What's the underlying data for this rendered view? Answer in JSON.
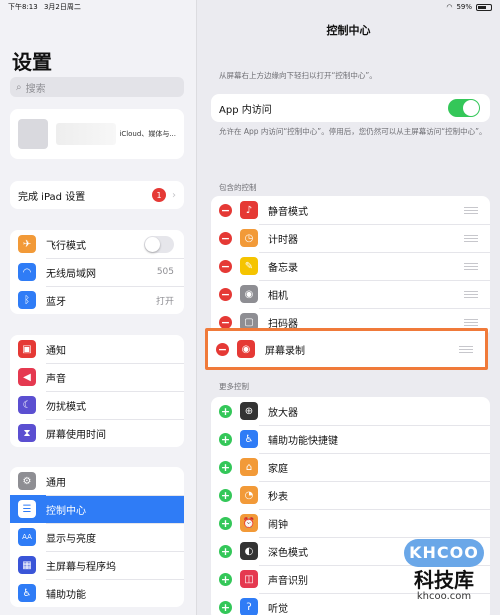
{
  "status": {
    "time": "下午8:13",
    "date": "3月2日周二",
    "wifi": "wifi-icon",
    "battery": "59%"
  },
  "sidebar": {
    "title": "设置",
    "search_placeholder": "搜索",
    "profile_sub": "iCloud、媒体与...",
    "finish_setup": "完成 iPad 设置",
    "finish_badge": "1",
    "group1": [
      {
        "label": "飞行模式",
        "icon": "airplane-icon",
        "color": "#f29a38"
      },
      {
        "label": "无线局域网",
        "value": "505",
        "icon": "wifi-icon",
        "color": "#2f7cf6"
      },
      {
        "label": "蓝牙",
        "value": "打开",
        "icon": "bluetooth-icon",
        "color": "#2f7cf6"
      }
    ],
    "group2": [
      {
        "label": "通知",
        "icon": "notification-icon",
        "color": "#e53935"
      },
      {
        "label": "声音",
        "icon": "sound-icon",
        "color": "#e53950"
      },
      {
        "label": "勿扰模式",
        "icon": "moon-icon",
        "color": "#5b4fd1"
      },
      {
        "label": "屏幕使用时间",
        "icon": "hourglass-icon",
        "color": "#5b4fd1"
      }
    ],
    "group3": [
      {
        "label": "通用",
        "icon": "gear-icon",
        "color": "#8e8e93"
      },
      {
        "label": "控制中心",
        "icon": "control-center-icon",
        "color": "#8e8e93"
      },
      {
        "label": "显示与亮度",
        "icon": "display-icon",
        "color": "#2f7cf6"
      },
      {
        "label": "主屏幕与程序坞",
        "icon": "home-screen-icon",
        "color": "#3a55d8"
      },
      {
        "label": "辅助功能",
        "icon": "accessibility-icon",
        "color": "#2f7cf6"
      }
    ]
  },
  "main": {
    "title": "控制中心",
    "desc": "从屏幕右上方边缘向下轻扫以打开“控制中心”。",
    "in_app_label": "App 内访问",
    "in_app_note": "允许在 App 内访问“控制中心”。停用后，您仍然可以从主屏幕访问“控制中心”。",
    "included_head": "包含的控制",
    "included": [
      {
        "label": "静音模式",
        "icon": "bell-icon",
        "color": "#e53935"
      },
      {
        "label": "计时器",
        "icon": "timer-icon",
        "color": "#f29a38"
      },
      {
        "label": "备忘录",
        "icon": "notes-icon",
        "color": "#f5c400"
      },
      {
        "label": "相机",
        "icon": "camera-icon",
        "color": "#8e8e93"
      },
      {
        "label": "扫码器",
        "icon": "qr-scanner-icon",
        "color": "#8e8e93"
      }
    ],
    "screen_record": {
      "label": "屏幕录制",
      "icon": "record-icon",
      "color": "#e53935"
    },
    "more_head": "更多控制",
    "more": [
      {
        "label": "放大器",
        "icon": "magnifier-icon",
        "color": "#333"
      },
      {
        "label": "辅助功能快捷键",
        "icon": "accessibility-icon",
        "color": "#2f7cf6"
      },
      {
        "label": "家庭",
        "icon": "home-icon",
        "color": "#f29a38"
      },
      {
        "label": "秒表",
        "icon": "stopwatch-icon",
        "color": "#f29a38"
      },
      {
        "label": "闹钟",
        "icon": "alarm-icon",
        "color": "#f29a38"
      },
      {
        "label": "深色模式",
        "icon": "dark-mode-icon",
        "color": "#333"
      },
      {
        "label": "声音识别",
        "icon": "sound-recognition-icon",
        "color": "#e53950"
      },
      {
        "label": "听觉",
        "icon": "ear-icon",
        "color": "#2f7cf6"
      }
    ]
  },
  "watermark": {
    "logo": "KHCOO",
    "name": "科技库",
    "url": "khcoo.com"
  }
}
